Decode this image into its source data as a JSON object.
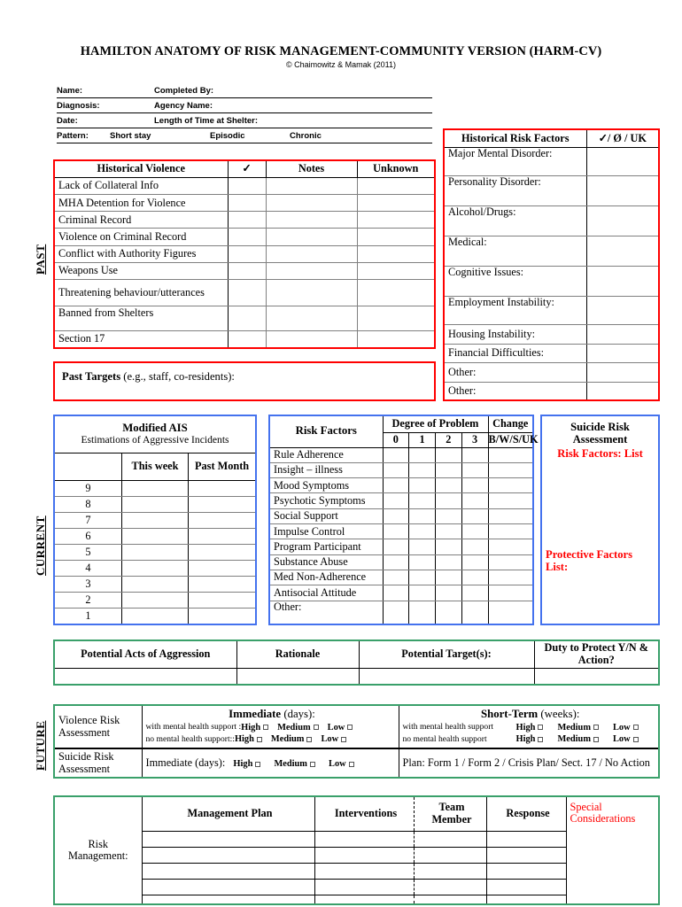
{
  "title": "HAMILTON ANATOMY OF RISK MANAGEMENT-COMMUNITY VERSION (HARM-CV)",
  "copyright": "© Chaimowitz & Mamak (2011)",
  "header_fields": {
    "name": "Name:",
    "completed_by": "Completed By:",
    "diagnosis": "Diagnosis:",
    "agency_name": "Agency Name:",
    "date": "Date:",
    "length_of_time": "Length of Time at Shelter:",
    "pattern": "Pattern:",
    "pattern_options": [
      "Short stay",
      "Episodic",
      "Chronic"
    ]
  },
  "eras": {
    "past": "PAST",
    "current": "CURRENT",
    "future": "FUTURE"
  },
  "historical_violence": {
    "columns": [
      "Historical Violence",
      "✓",
      "Notes",
      "Unknown"
    ],
    "rows": [
      "Lack of Collateral Info",
      "MHA Detention for Violence",
      "Criminal Record",
      "Violence on Criminal Record",
      "Conflict with Authority Figures",
      "Weapons Use",
      "Threatening behaviour/utterances",
      "Banned from Shelters",
      "Section 17"
    ]
  },
  "past_targets": {
    "bold": "Past Targets",
    "rest": " (e.g., staff, co-residents):"
  },
  "historical_risk_factors": {
    "columns": [
      "Historical Risk Factors",
      "✓/ Ø / UK"
    ],
    "rows": [
      "Major Mental Disorder:",
      "Personality Disorder:",
      "Alcohol/Drugs:",
      "Medical:",
      "Cognitive Issues:",
      "Employment Instability:",
      "Housing Instability:",
      "Financial Difficulties:",
      "Other:",
      "Other:"
    ]
  },
  "modified_ais": {
    "title": "Modified AIS",
    "subtitle": "Estimations of Aggressive Incidents",
    "columns": [
      "",
      "This week",
      "Past Month"
    ],
    "scale": [
      "9",
      "8",
      "7",
      "6",
      "5",
      "4",
      "3",
      "2",
      "1"
    ]
  },
  "risk_factors": {
    "title": "Risk Factors",
    "degree_header": "Degree of Problem",
    "degree_levels": [
      "0",
      "1",
      "2",
      "3"
    ],
    "change_header": "Change",
    "change_key": "B/W/S/UK",
    "rows": [
      "Rule Adherence",
      "Insight – illness",
      "Mood Symptoms",
      "Psychotic Symptoms",
      "Social Support",
      "Impulse Control",
      "Program Participant",
      "Substance Abuse",
      "Med Non-Adherence",
      "Antisocial Attitude",
      "Other:"
    ]
  },
  "suicide_risk_assessment_current": {
    "title_line1": "Suicide Risk",
    "title_line2": "Assessment",
    "risk_factors_label": "Risk Factors: List",
    "protective_label_line1": "Protective Factors",
    "protective_label_line2": "List:"
  },
  "potential_aggression": {
    "columns": [
      "Potential Acts of Aggression",
      "Rationale",
      "Potential Target(s):",
      "Duty to Protect Y/N & Action?"
    ]
  },
  "violence_risk_assessment": {
    "label_line1": "Violence Risk",
    "label_line2": "Assessment",
    "immediate_bold": "Immediate",
    "immediate_rest": " (days):",
    "short_term_bold": "Short-Term",
    "short_term_rest": " (weeks):",
    "imm_row1_who": "with mental health support :",
    "imm_row2_who": "no mental health  support::",
    "st_row1_who": "with mental health support",
    "st_row2_who": "no mental health  support",
    "options": [
      "High",
      "Medium",
      "Low"
    ]
  },
  "suicide_risk_assessment_future": {
    "label_line1": "Suicide Risk",
    "label_line2": "Assessment",
    "immediate_bold": "Immediate",
    "immediate_rest": " (days):",
    "options": [
      "High",
      "Medium",
      "Low"
    ],
    "plan_bold": "Plan:",
    "plan_rest": " Form 1 / Form 2 / Crisis Plan/ Sect. 17 / No Action"
  },
  "risk_management": {
    "label_line1": "Risk",
    "label_line2": "Management:",
    "columns": [
      "Management Plan",
      "Interventions",
      "Team Member",
      "Response"
    ],
    "special_line1": "Special",
    "special_line2": "Considerations",
    "row_count": 5
  },
  "colors": {
    "past_border": "#ff0000",
    "current_border": "#4472ee",
    "future_border": "#3aa06a",
    "accent_red": "#ff0000",
    "grid_gray": "#808080"
  }
}
